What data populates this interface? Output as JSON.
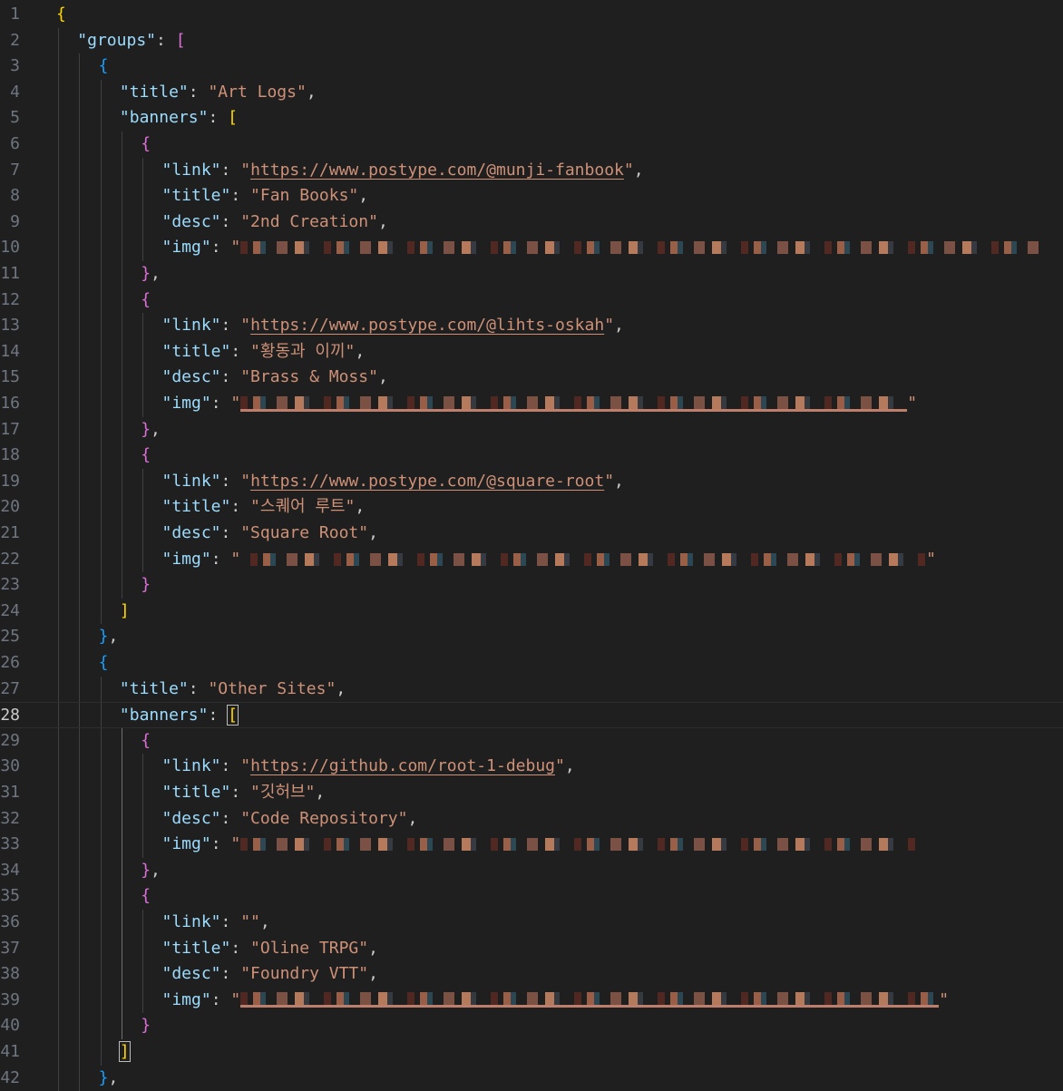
{
  "editor": {
    "active_line": "28",
    "lines": [
      {
        "n": "1",
        "i": 0,
        "t": [
          [
            "b1",
            "{"
          ]
        ]
      },
      {
        "n": "2",
        "i": 1,
        "t": [
          [
            "key",
            "\"groups\""
          ],
          [
            "p",
            ": "
          ],
          [
            "b2",
            "["
          ]
        ]
      },
      {
        "n": "3",
        "i": 2,
        "t": [
          [
            "b3",
            "{"
          ]
        ]
      },
      {
        "n": "4",
        "i": 3,
        "t": [
          [
            "key",
            "\"title\""
          ],
          [
            "p",
            ": "
          ],
          [
            "str",
            "\"Art Logs\""
          ],
          [
            "p",
            ","
          ]
        ]
      },
      {
        "n": "5",
        "i": 3,
        "t": [
          [
            "key",
            "\"banners\""
          ],
          [
            "p",
            ": "
          ],
          [
            "b1",
            "["
          ]
        ]
      },
      {
        "n": "6",
        "i": 4,
        "t": [
          [
            "b2",
            "{"
          ]
        ]
      },
      {
        "n": "7",
        "i": 5,
        "t": [
          [
            "key",
            "\"link\""
          ],
          [
            "p",
            ": "
          ],
          [
            "str",
            "\""
          ],
          [
            "link",
            "https://www.postype.com/@munji-fanbook"
          ],
          [
            "str",
            "\""
          ],
          [
            "p",
            ","
          ]
        ]
      },
      {
        "n": "8",
        "i": 5,
        "t": [
          [
            "key",
            "\"title\""
          ],
          [
            "p",
            ": "
          ],
          [
            "str",
            "\"Fan Books\""
          ],
          [
            "p",
            ","
          ]
        ]
      },
      {
        "n": "9",
        "i": 5,
        "t": [
          [
            "key",
            "\"desc\""
          ],
          [
            "p",
            ": "
          ],
          [
            "str",
            "\"2nd Creation\""
          ],
          [
            "p",
            ","
          ]
        ]
      },
      {
        "n": "10",
        "i": 5,
        "t": [
          [
            "key",
            "\"img\""
          ],
          [
            "p",
            ": "
          ],
          [
            "str",
            "\""
          ],
          [
            "censor",
            "880"
          ]
        ]
      },
      {
        "n": "11",
        "i": 4,
        "t": [
          [
            "b2",
            "}"
          ],
          [
            "p",
            ","
          ]
        ]
      },
      {
        "n": "12",
        "i": 4,
        "t": [
          [
            "b2",
            "{"
          ]
        ]
      },
      {
        "n": "13",
        "i": 5,
        "t": [
          [
            "key",
            "\"link\""
          ],
          [
            "p",
            ": "
          ],
          [
            "str",
            "\""
          ],
          [
            "link",
            "https://www.postype.com/@lihts-oskah"
          ],
          [
            "str",
            "\""
          ],
          [
            "p",
            ","
          ]
        ]
      },
      {
        "n": "14",
        "i": 5,
        "t": [
          [
            "key",
            "\"title\""
          ],
          [
            "p",
            ": "
          ],
          [
            "str",
            "\"황동과 이끼\""
          ],
          [
            "p",
            ","
          ]
        ]
      },
      {
        "n": "15",
        "i": 5,
        "t": [
          [
            "key",
            "\"desc\""
          ],
          [
            "p",
            ": "
          ],
          [
            "str",
            "\"Brass & Moss\""
          ],
          [
            "p",
            ","
          ]
        ]
      },
      {
        "n": "16",
        "i": 5,
        "t": [
          [
            "key",
            "\"img\""
          ],
          [
            "p",
            ": "
          ],
          [
            "str",
            "\""
          ],
          [
            "censor-u",
            "735"
          ],
          [
            "str",
            "\""
          ]
        ]
      },
      {
        "n": "17",
        "i": 4,
        "t": [
          [
            "b2",
            "}"
          ],
          [
            "p",
            ","
          ]
        ]
      },
      {
        "n": "18",
        "i": 4,
        "t": [
          [
            "b2",
            "{"
          ]
        ]
      },
      {
        "n": "19",
        "i": 5,
        "t": [
          [
            "key",
            "\"link\""
          ],
          [
            "p",
            ": "
          ],
          [
            "str",
            "\""
          ],
          [
            "link",
            "https://www.postype.com/@square-root"
          ],
          [
            "str",
            "\""
          ],
          [
            "p",
            ","
          ]
        ]
      },
      {
        "n": "20",
        "i": 5,
        "t": [
          [
            "key",
            "\"title\""
          ],
          [
            "p",
            ": "
          ],
          [
            "str",
            "\"스퀘어 루트\""
          ],
          [
            "p",
            ","
          ]
        ]
      },
      {
        "n": "21",
        "i": 5,
        "t": [
          [
            "key",
            "\"desc\""
          ],
          [
            "p",
            ": "
          ],
          [
            "str",
            "\"Square Root\""
          ],
          [
            "p",
            ","
          ]
        ]
      },
      {
        "n": "22",
        "i": 5,
        "t": [
          [
            "key",
            "\"img\""
          ],
          [
            "p",
            ": "
          ],
          [
            "str",
            "\" "
          ],
          [
            "censor",
            "745"
          ],
          [
            "str",
            "\""
          ]
        ]
      },
      {
        "n": "23",
        "i": 4,
        "t": [
          [
            "b2",
            "}"
          ]
        ]
      },
      {
        "n": "24",
        "i": 3,
        "t": [
          [
            "b1",
            "]"
          ]
        ]
      },
      {
        "n": "25",
        "i": 2,
        "t": [
          [
            "b3",
            "}"
          ],
          [
            "p",
            ","
          ]
        ]
      },
      {
        "n": "26",
        "i": 2,
        "t": [
          [
            "b3",
            "{"
          ]
        ]
      },
      {
        "n": "27",
        "i": 3,
        "t": [
          [
            "key",
            "\"title\""
          ],
          [
            "p",
            ": "
          ],
          [
            "str",
            "\"Other Sites\""
          ],
          [
            "p",
            ","
          ]
        ]
      },
      {
        "n": "28",
        "i": 3,
        "t": [
          [
            "key",
            "\"banners\""
          ],
          [
            "p",
            ": "
          ],
          [
            "b1m",
            "["
          ]
        ]
      },
      {
        "n": "29",
        "i": 4,
        "t": [
          [
            "b2",
            "{"
          ]
        ]
      },
      {
        "n": "30",
        "i": 5,
        "t": [
          [
            "key",
            "\"link\""
          ],
          [
            "p",
            ": "
          ],
          [
            "str",
            "\""
          ],
          [
            "link",
            "https://github.com/root-1-debug"
          ],
          [
            "str",
            "\""
          ],
          [
            "p",
            ","
          ]
        ]
      },
      {
        "n": "31",
        "i": 5,
        "t": [
          [
            "key",
            "\"title\""
          ],
          [
            "p",
            ": "
          ],
          [
            "str",
            "\"깃허브\""
          ],
          [
            "p",
            ","
          ]
        ]
      },
      {
        "n": "32",
        "i": 5,
        "t": [
          [
            "key",
            "\"desc\""
          ],
          [
            "p",
            ": "
          ],
          [
            "str",
            "\"Code Repository\""
          ],
          [
            "p",
            ","
          ]
        ]
      },
      {
        "n": "33",
        "i": 5,
        "t": [
          [
            "key",
            "\"img\""
          ],
          [
            "p",
            ": "
          ],
          [
            "str",
            "\""
          ],
          [
            "censor",
            "745"
          ]
        ]
      },
      {
        "n": "34",
        "i": 4,
        "t": [
          [
            "b2",
            "}"
          ],
          [
            "p",
            ","
          ]
        ]
      },
      {
        "n": "35",
        "i": 4,
        "t": [
          [
            "b2",
            "{"
          ]
        ]
      },
      {
        "n": "36",
        "i": 5,
        "t": [
          [
            "key",
            "\"link\""
          ],
          [
            "p",
            ": "
          ],
          [
            "str",
            "\"\""
          ],
          [
            "p",
            ","
          ]
        ]
      },
      {
        "n": "37",
        "i": 5,
        "t": [
          [
            "key",
            "\"title\""
          ],
          [
            "p",
            ": "
          ],
          [
            "str",
            "\"Oline TRPG\""
          ],
          [
            "p",
            ","
          ]
        ]
      },
      {
        "n": "38",
        "i": 5,
        "t": [
          [
            "key",
            "\"desc\""
          ],
          [
            "p",
            ": "
          ],
          [
            "str",
            "\"Foundry VTT\""
          ],
          [
            "p",
            ","
          ]
        ]
      },
      {
        "n": "39",
        "i": 5,
        "t": [
          [
            "key",
            "\"img\""
          ],
          [
            "p",
            ": "
          ],
          [
            "str",
            "\""
          ],
          [
            "censor-u",
            "770"
          ],
          [
            "str",
            "\""
          ]
        ]
      },
      {
        "n": "40",
        "i": 4,
        "t": [
          [
            "b2",
            "}"
          ]
        ]
      },
      {
        "n": "41",
        "i": 3,
        "t": [
          [
            "b1m",
            "]"
          ]
        ]
      },
      {
        "n": "42",
        "i": 2,
        "t": [
          [
            "b3",
            "}"
          ],
          [
            "p",
            ","
          ]
        ]
      }
    ]
  }
}
